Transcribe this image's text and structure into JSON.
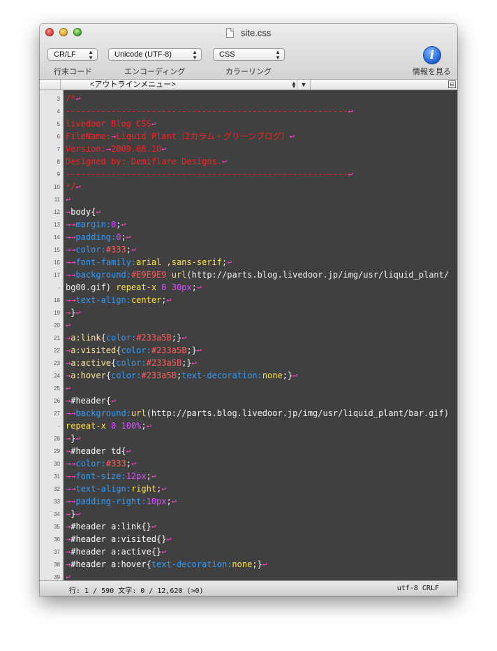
{
  "window": {
    "title": "site.css"
  },
  "toolbar": {
    "line_ending": {
      "value": "CR/LF",
      "label": "行末コード"
    },
    "encoding": {
      "value": "Unicode (UTF-8)",
      "label": "エンコーディング"
    },
    "coloring": {
      "value": "CSS",
      "label": "カラーリング"
    },
    "info": {
      "glyph": "i",
      "label": "情報を見る"
    }
  },
  "outline": {
    "menu_label": "<アウトラインメニュー>"
  },
  "editor": {
    "lines": [
      {
        "ln": "3",
        "tokens": [
          [
            "comment",
            "/*"
          ],
          [
            "ctl",
            "↩"
          ]
        ]
      },
      {
        "ln": "4",
        "tokens": [
          [
            "comment",
            "--------------------------------------------------------"
          ],
          [
            "ctl",
            "↩"
          ]
        ]
      },
      {
        "ln": "5",
        "tokens": [
          [
            "comment",
            "livedoor Blog CSS"
          ],
          [
            "ctl",
            "↩"
          ]
        ]
      },
      {
        "ln": "6",
        "tokens": [
          [
            "comment",
            "FileName:"
          ],
          [
            "ctl",
            "→"
          ],
          [
            "comment",
            "Liquid Plant（2カラム・グリーンブログ）"
          ],
          [
            "ctl",
            "↩"
          ]
        ]
      },
      {
        "ln": "7",
        "tokens": [
          [
            "comment",
            "Version:"
          ],
          [
            "ctl",
            "→"
          ],
          [
            "comment",
            "2009.08.10"
          ],
          [
            "ctl",
            "↩"
          ]
        ]
      },
      {
        "ln": "8",
        "tokens": [
          [
            "comment",
            "Designed by: Demiflare Designs."
          ],
          [
            "ctl",
            "↩"
          ]
        ]
      },
      {
        "ln": "9",
        "tokens": [
          [
            "comment",
            "--------------------------------------------------------"
          ],
          [
            "ctl",
            "↩"
          ]
        ]
      },
      {
        "ln": "10",
        "tokens": [
          [
            "comment",
            "*/"
          ],
          [
            "ctl",
            "↩"
          ]
        ]
      },
      {
        "ln": "11",
        "tokens": [
          [
            "ctl",
            "↩"
          ]
        ]
      },
      {
        "ln": "12",
        "tokens": [
          [
            "ctl",
            "→"
          ],
          [
            "sel",
            "body{"
          ],
          [
            "ctl",
            "↩"
          ]
        ]
      },
      {
        "ln": "13",
        "tokens": [
          [
            "ctl",
            "→→"
          ],
          [
            "prop",
            "margin:"
          ],
          [
            "num",
            "0"
          ],
          [
            "plain",
            ";"
          ],
          [
            "ctl",
            "↩"
          ]
        ]
      },
      {
        "ln": "14",
        "tokens": [
          [
            "ctl",
            "→→"
          ],
          [
            "prop",
            "padding:"
          ],
          [
            "num",
            "0"
          ],
          [
            "plain",
            ";"
          ],
          [
            "ctl",
            "↩"
          ]
        ]
      },
      {
        "ln": "15",
        "tokens": [
          [
            "ctl",
            "→→"
          ],
          [
            "prop",
            "color:"
          ],
          [
            "color",
            "#333"
          ],
          [
            "plain",
            ";"
          ],
          [
            "ctl",
            "↩"
          ]
        ]
      },
      {
        "ln": "16",
        "tokens": [
          [
            "ctl",
            "→→"
          ],
          [
            "prop",
            "font-family:"
          ],
          [
            "val",
            "arial ,sans-serif"
          ],
          [
            "plain",
            ";"
          ],
          [
            "ctl",
            "↩"
          ]
        ]
      },
      {
        "ln": "17",
        "tokens": [
          [
            "ctl",
            "→→"
          ],
          [
            "prop",
            "background:"
          ],
          [
            "color",
            "#E9E9E9"
          ],
          [
            "val",
            " url"
          ],
          [
            "plain",
            "(http://parts.blog.livedoor.jp/img/usr/liquid_plant/"
          ]
        ]
      },
      {
        "ln": "-",
        "tokens": [
          [
            "plain",
            "bg00.gif)"
          ],
          [
            "val",
            " repeat-x"
          ],
          [
            "num",
            " 0 30px"
          ],
          [
            "plain",
            ";"
          ],
          [
            "ctl",
            "↩"
          ]
        ]
      },
      {
        "ln": "18",
        "tokens": [
          [
            "ctl",
            "→→"
          ],
          [
            "prop",
            "text-align:"
          ],
          [
            "val",
            "center"
          ],
          [
            "plain",
            ";"
          ],
          [
            "ctl",
            "↩"
          ]
        ]
      },
      {
        "ln": "19",
        "tokens": [
          [
            "ctl",
            "→"
          ],
          [
            "sel",
            "}"
          ],
          [
            "ctl",
            "↩"
          ]
        ]
      },
      {
        "ln": "20",
        "tokens": [
          [
            "ctl",
            "↩"
          ]
        ]
      },
      {
        "ln": "21",
        "tokens": [
          [
            "ctl",
            "→"
          ],
          [
            "pseudo",
            "a:link"
          ],
          [
            "plain",
            "{"
          ],
          [
            "prop",
            "color:"
          ],
          [
            "color",
            "#233a5B"
          ],
          [
            "plain",
            ";}"
          ],
          [
            "ctl",
            "↩"
          ]
        ]
      },
      {
        "ln": "22",
        "tokens": [
          [
            "ctl",
            "→"
          ],
          [
            "pseudo",
            "a:visited"
          ],
          [
            "plain",
            "{"
          ],
          [
            "prop",
            "color:"
          ],
          [
            "color",
            "#233a5B"
          ],
          [
            "plain",
            ";}"
          ],
          [
            "ctl",
            "↩"
          ]
        ]
      },
      {
        "ln": "23",
        "tokens": [
          [
            "ctl",
            "→"
          ],
          [
            "pseudo",
            "a:active"
          ],
          [
            "plain",
            "{"
          ],
          [
            "prop",
            "color:"
          ],
          [
            "color",
            "#233a5B"
          ],
          [
            "plain",
            ";}"
          ],
          [
            "ctl",
            "↩"
          ]
        ]
      },
      {
        "ln": "24",
        "tokens": [
          [
            "ctl",
            "→"
          ],
          [
            "pseudo",
            "a:hover"
          ],
          [
            "plain",
            "{"
          ],
          [
            "prop",
            "color:"
          ],
          [
            "color",
            "#233a5B"
          ],
          [
            "plain",
            ";"
          ],
          [
            "prop",
            "text-decoration:"
          ],
          [
            "val",
            "none"
          ],
          [
            "plain",
            ";}"
          ],
          [
            "ctl",
            "↩"
          ]
        ]
      },
      {
        "ln": "25",
        "tokens": [
          [
            "ctl",
            "↩"
          ]
        ]
      },
      {
        "ln": "26",
        "tokens": [
          [
            "ctl",
            "→"
          ],
          [
            "sel",
            "#header{"
          ],
          [
            "ctl",
            "↩"
          ]
        ]
      },
      {
        "ln": "27",
        "tokens": [
          [
            "ctl",
            "→→"
          ],
          [
            "prop",
            "background:"
          ],
          [
            "val",
            "url"
          ],
          [
            "plain",
            "(http://parts.blog.livedoor.jp/img/usr/liquid_plant/bar.gif)"
          ]
        ]
      },
      {
        "ln": "-",
        "tokens": [
          [
            "val",
            "repeat-x"
          ],
          [
            "num",
            " 0 100%"
          ],
          [
            "plain",
            ";"
          ],
          [
            "ctl",
            "↩"
          ]
        ]
      },
      {
        "ln": "28",
        "tokens": [
          [
            "ctl",
            "→"
          ],
          [
            "sel",
            "}"
          ],
          [
            "ctl",
            "↩"
          ]
        ]
      },
      {
        "ln": "29",
        "tokens": [
          [
            "ctl",
            "→"
          ],
          [
            "sel",
            "#header td{"
          ],
          [
            "ctl",
            "↩"
          ]
        ]
      },
      {
        "ln": "30",
        "tokens": [
          [
            "ctl",
            "→→"
          ],
          [
            "prop",
            "color:"
          ],
          [
            "color",
            "#333"
          ],
          [
            "plain",
            ";"
          ],
          [
            "ctl",
            "↩"
          ]
        ]
      },
      {
        "ln": "31",
        "tokens": [
          [
            "ctl",
            "→→"
          ],
          [
            "prop",
            "font-size:"
          ],
          [
            "num",
            "12px"
          ],
          [
            "plain",
            ";"
          ],
          [
            "ctl",
            "↩"
          ]
        ]
      },
      {
        "ln": "32",
        "tokens": [
          [
            "ctl",
            "→→"
          ],
          [
            "prop",
            "text-align:"
          ],
          [
            "val",
            "right"
          ],
          [
            "plain",
            ";"
          ],
          [
            "ctl",
            "↩"
          ]
        ]
      },
      {
        "ln": "33",
        "tokens": [
          [
            "ctl",
            "→→"
          ],
          [
            "prop",
            "padding-right:"
          ],
          [
            "num",
            "10px"
          ],
          [
            "plain",
            ";"
          ],
          [
            "ctl",
            "↩"
          ]
        ]
      },
      {
        "ln": "34",
        "tokens": [
          [
            "ctl",
            "→"
          ],
          [
            "sel",
            "}"
          ],
          [
            "ctl",
            "↩"
          ]
        ]
      },
      {
        "ln": "35",
        "tokens": [
          [
            "ctl",
            "→"
          ],
          [
            "sel",
            "#header a:link{}"
          ],
          [
            "ctl",
            "↩"
          ]
        ]
      },
      {
        "ln": "36",
        "tokens": [
          [
            "ctl",
            "→"
          ],
          [
            "sel",
            "#header a:visited{}"
          ],
          [
            "ctl",
            "↩"
          ]
        ]
      },
      {
        "ln": "37",
        "tokens": [
          [
            "ctl",
            "→"
          ],
          [
            "sel",
            "#header a:active{}"
          ],
          [
            "ctl",
            "↩"
          ]
        ]
      },
      {
        "ln": "38",
        "tokens": [
          [
            "ctl",
            "→"
          ],
          [
            "sel",
            "#header a:hover{"
          ],
          [
            "prop",
            "text-decoration:"
          ],
          [
            "val",
            "none"
          ],
          [
            "plain",
            ";}"
          ],
          [
            "ctl",
            "↩"
          ]
        ]
      },
      {
        "ln": "39",
        "tokens": [
          [
            "ctl",
            "↩"
          ]
        ]
      }
    ]
  },
  "status": {
    "position": "行: 1 / 590  文字: 0 / 12,620 (>0)",
    "encoding": "utf-8 CRLF"
  },
  "colors": {
    "comment": "#ff2020",
    "property": "#2f9bff",
    "value": "#ffe14a",
    "number": "#d84dff",
    "control": "#ff43c8",
    "editor_bg": "#404040"
  }
}
